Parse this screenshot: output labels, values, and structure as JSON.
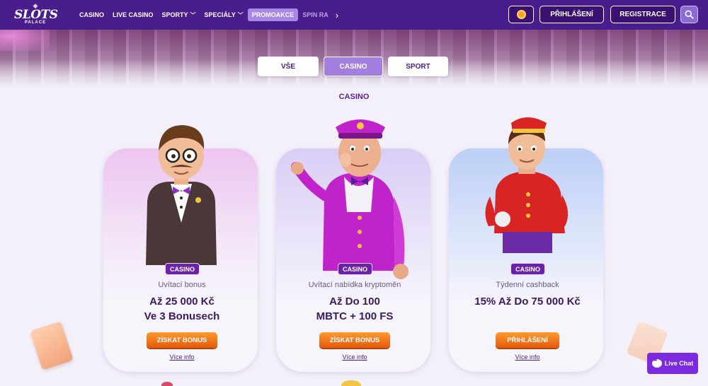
{
  "header": {
    "logo": {
      "main": "SLOTS",
      "sub": "PALACE"
    },
    "nav": [
      {
        "label": "CASINO",
        "active": false
      },
      {
        "label": "LIVE CASINO",
        "active": false
      },
      {
        "label": "SPORTY",
        "active": false,
        "dropdown": true
      },
      {
        "label": "SPECIÁLY",
        "active": false,
        "dropdown": true
      },
      {
        "label": "PROMOAKCE",
        "active": true
      },
      {
        "label": "SPIN RA",
        "active": false
      }
    ],
    "login_label": "PŘIHLÁŠENÍ",
    "register_label": "REGISTRACE"
  },
  "tabs": [
    {
      "label": "VŠE",
      "active": false
    },
    {
      "label": "CASINO",
      "active": true
    },
    {
      "label": "SPORT",
      "active": false
    }
  ],
  "section_title": "CASINO",
  "cards": [
    {
      "badge": "CASINO",
      "subtitle": "Uvítací bonus",
      "headline_1": "Až 25 000 Kč",
      "headline_2": "Ve 3 Bonusech",
      "cta": "ZÍSKAT BONUS",
      "more": "Více info"
    },
    {
      "badge": "CASINO",
      "subtitle": "Uvítací nabídka kryptoměn",
      "headline_1": "Až Do 100",
      "headline_2": "MBTC + 100 FS",
      "cta": "ZÍSKAT BONUS",
      "more": "Více info"
    },
    {
      "badge": "CASINO",
      "subtitle": "Týdenní cashback",
      "headline_1": "15% Až Do 75 000 Kč",
      "headline_2": "",
      "cta": "PŘIHLÁŠENÍ",
      "more": "Více info"
    }
  ],
  "live_chat_label": "Live Chat",
  "colors": {
    "header": "#4a1d8c",
    "accent": "#a987e6",
    "cta": "#f07a1c",
    "badge": "#6b21a8"
  }
}
